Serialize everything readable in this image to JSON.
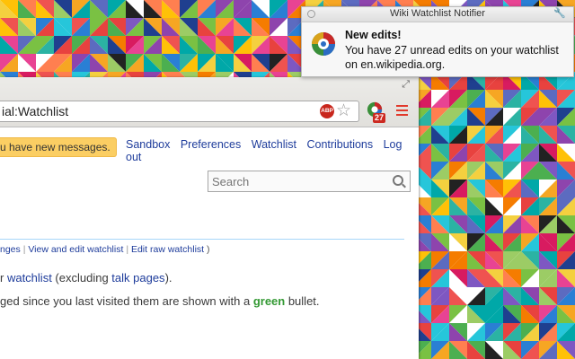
{
  "notification": {
    "title": "Wiki Watchlist Notifier",
    "heading": "New edits!",
    "body": "You have 27 unread edits on your watchlist on en.wikipedia.org.",
    "icon": "wikipedia-globe-icon"
  },
  "browser": {
    "address": "ial:Watchlist",
    "adblock_label": "ABP",
    "extension_badge": "27",
    "icons": [
      "adblock-icon",
      "star-icon",
      "wiki-watchlist-extension-icon",
      "menu-icon"
    ]
  },
  "page": {
    "new_messages": "u have new messages.",
    "nav_links": [
      "Sandbox",
      "Preferences",
      "Watchlist",
      "Contributions",
      "Log out"
    ],
    "search_placeholder": "Search",
    "sublinks": {
      "changes": "nges",
      "view_edit": "View and edit watchlist",
      "edit_raw": "Edit raw watchlist",
      "tail": ")"
    },
    "paragraph1": {
      "before": "r ",
      "link1": "watchlist",
      "middle": " (excluding ",
      "link2": "talk pages",
      "after": ")."
    },
    "paragraph2": {
      "before": "ged since you last visited them are shown with a ",
      "green": "green",
      "after": " bullet."
    }
  },
  "colors": {
    "link": "#1e3c9b",
    "message_bar": "#fbce63",
    "green_text": "#339933",
    "badge": "#cc2a22"
  }
}
